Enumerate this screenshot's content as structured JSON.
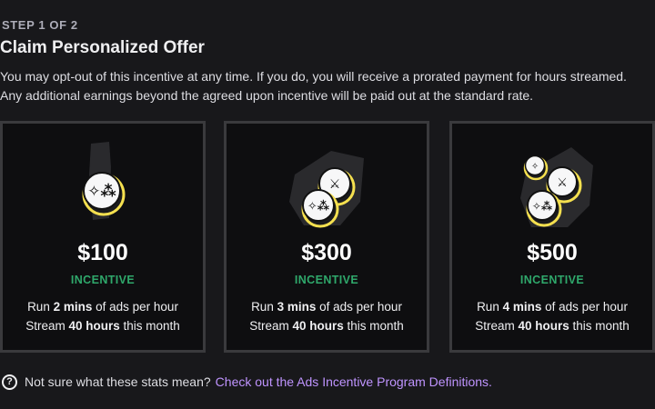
{
  "header": {
    "step": "STEP 1 OF 2",
    "title": "Claim Personalized Offer",
    "description": "You may opt-out of this incentive at any time. If you do, you will receive a prorated payment for hours streamed. Any additional earnings beyond the agreed upon incentive will be paid out at the standard rate."
  },
  "offers": [
    {
      "amount": "$100",
      "label": "INCENTIVE",
      "run_prefix": "Run ",
      "run_value": "2 mins",
      "run_suffix": " of ads per hour",
      "stream_prefix": "Stream ",
      "stream_value": "40 hours",
      "stream_suffix": " this month",
      "icon": "coin-stack-small-icon"
    },
    {
      "amount": "$300",
      "label": "INCENTIVE",
      "run_prefix": "Run ",
      "run_value": "3 mins",
      "run_suffix": " of ads per hour",
      "stream_prefix": "Stream ",
      "stream_value": "40 hours",
      "stream_suffix": " this month",
      "icon": "coin-stack-medium-icon"
    },
    {
      "amount": "$500",
      "label": "INCENTIVE",
      "run_prefix": "Run ",
      "run_value": "4 mins",
      "run_suffix": " of ads per hour",
      "stream_prefix": "Stream ",
      "stream_value": "40 hours",
      "stream_suffix": " this month",
      "icon": "coin-stack-large-icon"
    }
  ],
  "footer": {
    "question": "Not sure what these stats mean?",
    "link": "Check out the Ads Incentive Program Definitions.",
    "icon": "help-circle-icon"
  },
  "colors": {
    "background": "#18181b",
    "card_border": "#3a3a3d",
    "incentive_green": "#2fa86b",
    "link_purple": "#bf94ff"
  }
}
